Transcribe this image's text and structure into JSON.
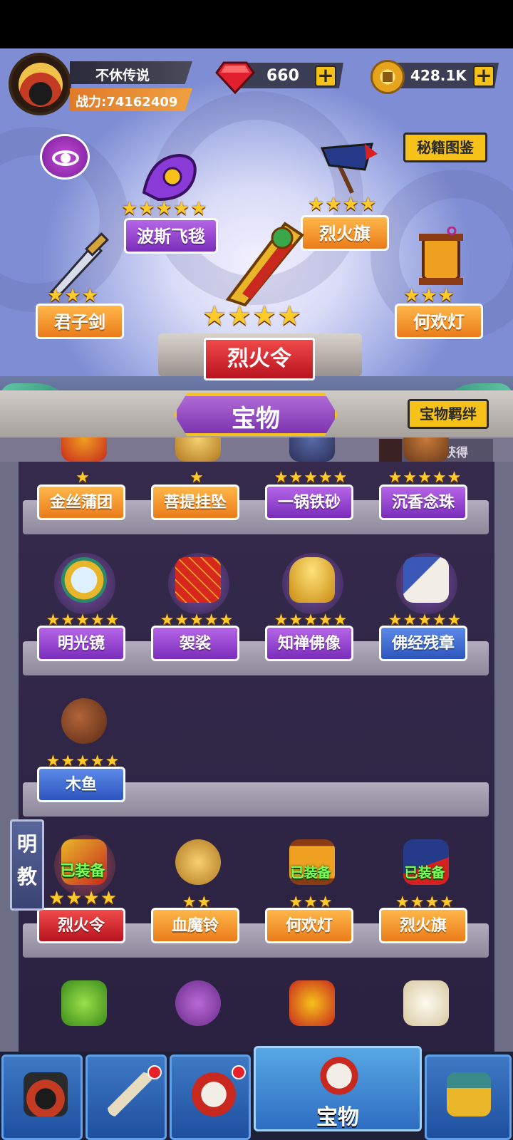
{
  "header": {
    "player_name": "不休传说",
    "power_label": "战力:74162409"
  },
  "currencies": {
    "gems": "660",
    "gold": "428.1K",
    "add_symbol": "+"
  },
  "showcase": {
    "codex_button": "秘籍图鉴",
    "items": [
      {
        "name": "波斯飞毯",
        "stars": 5,
        "color": "purple"
      },
      {
        "name": "烈火旗",
        "stars": 4,
        "color": "orange"
      },
      {
        "name": "君子剑",
        "stars": 3,
        "color": "orange"
      },
      {
        "name": "何欢灯",
        "stars": 3,
        "color": "orange"
      }
    ],
    "center_item": {
      "name": "烈火令",
      "stars": 4,
      "color": "red"
    }
  },
  "tabs": {
    "active_tab": "宝物",
    "bond_button": "宝物羁绊"
  },
  "shelf": {
    "show_unowned_label": "显示未获得",
    "equipped_label": "已装备",
    "rows": [
      [
        {
          "name": "金丝蒲团",
          "stars": 1,
          "color": "orange"
        },
        {
          "name": "菩提挂坠",
          "stars": 1,
          "color": "orange"
        },
        {
          "name": "一锅铁砂",
          "stars": 5,
          "color": "purple"
        },
        {
          "name": "沉香念珠",
          "stars": 5,
          "color": "purple"
        }
      ],
      [
        {
          "name": "明光镜",
          "stars": 5,
          "color": "purple"
        },
        {
          "name": "袈裟",
          "stars": 5,
          "color": "purple"
        },
        {
          "name": "知禅佛像",
          "stars": 5,
          "color": "purple"
        },
        {
          "name": "佛经残章",
          "stars": 5,
          "color": "blue"
        }
      ],
      [
        {
          "name": "木鱼",
          "stars": 5,
          "color": "blue"
        }
      ],
      [
        {
          "name": "烈火令",
          "stars": 4,
          "color": "red",
          "equipped": true
        },
        {
          "name": "血魔铃",
          "stars": 2,
          "color": "orange"
        },
        {
          "name": "何欢灯",
          "stars": 3,
          "color": "orange",
          "equipped": true
        },
        {
          "name": "烈火旗",
          "stars": 4,
          "color": "orange",
          "equipped": true
        }
      ]
    ],
    "sect_tag": "明\n教"
  },
  "bottom_nav": {
    "active_label": "宝物",
    "items": [
      {
        "icon": "hero-icon",
        "badge": false
      },
      {
        "icon": "sword-icon",
        "badge": true
      },
      {
        "icon": "drum-icon",
        "badge": true
      },
      {
        "icon": "scroll-treasure-icon",
        "badge": false,
        "active": true
      },
      {
        "icon": "gate-icon",
        "badge": false
      }
    ]
  },
  "colors": {
    "orange": "#ea7c1a",
    "purple": "#7a2dbb",
    "red": "#b8141f",
    "blue": "#2d55be",
    "gold_star": "#ffcb2b",
    "equipped_green": "#7dff5b"
  }
}
